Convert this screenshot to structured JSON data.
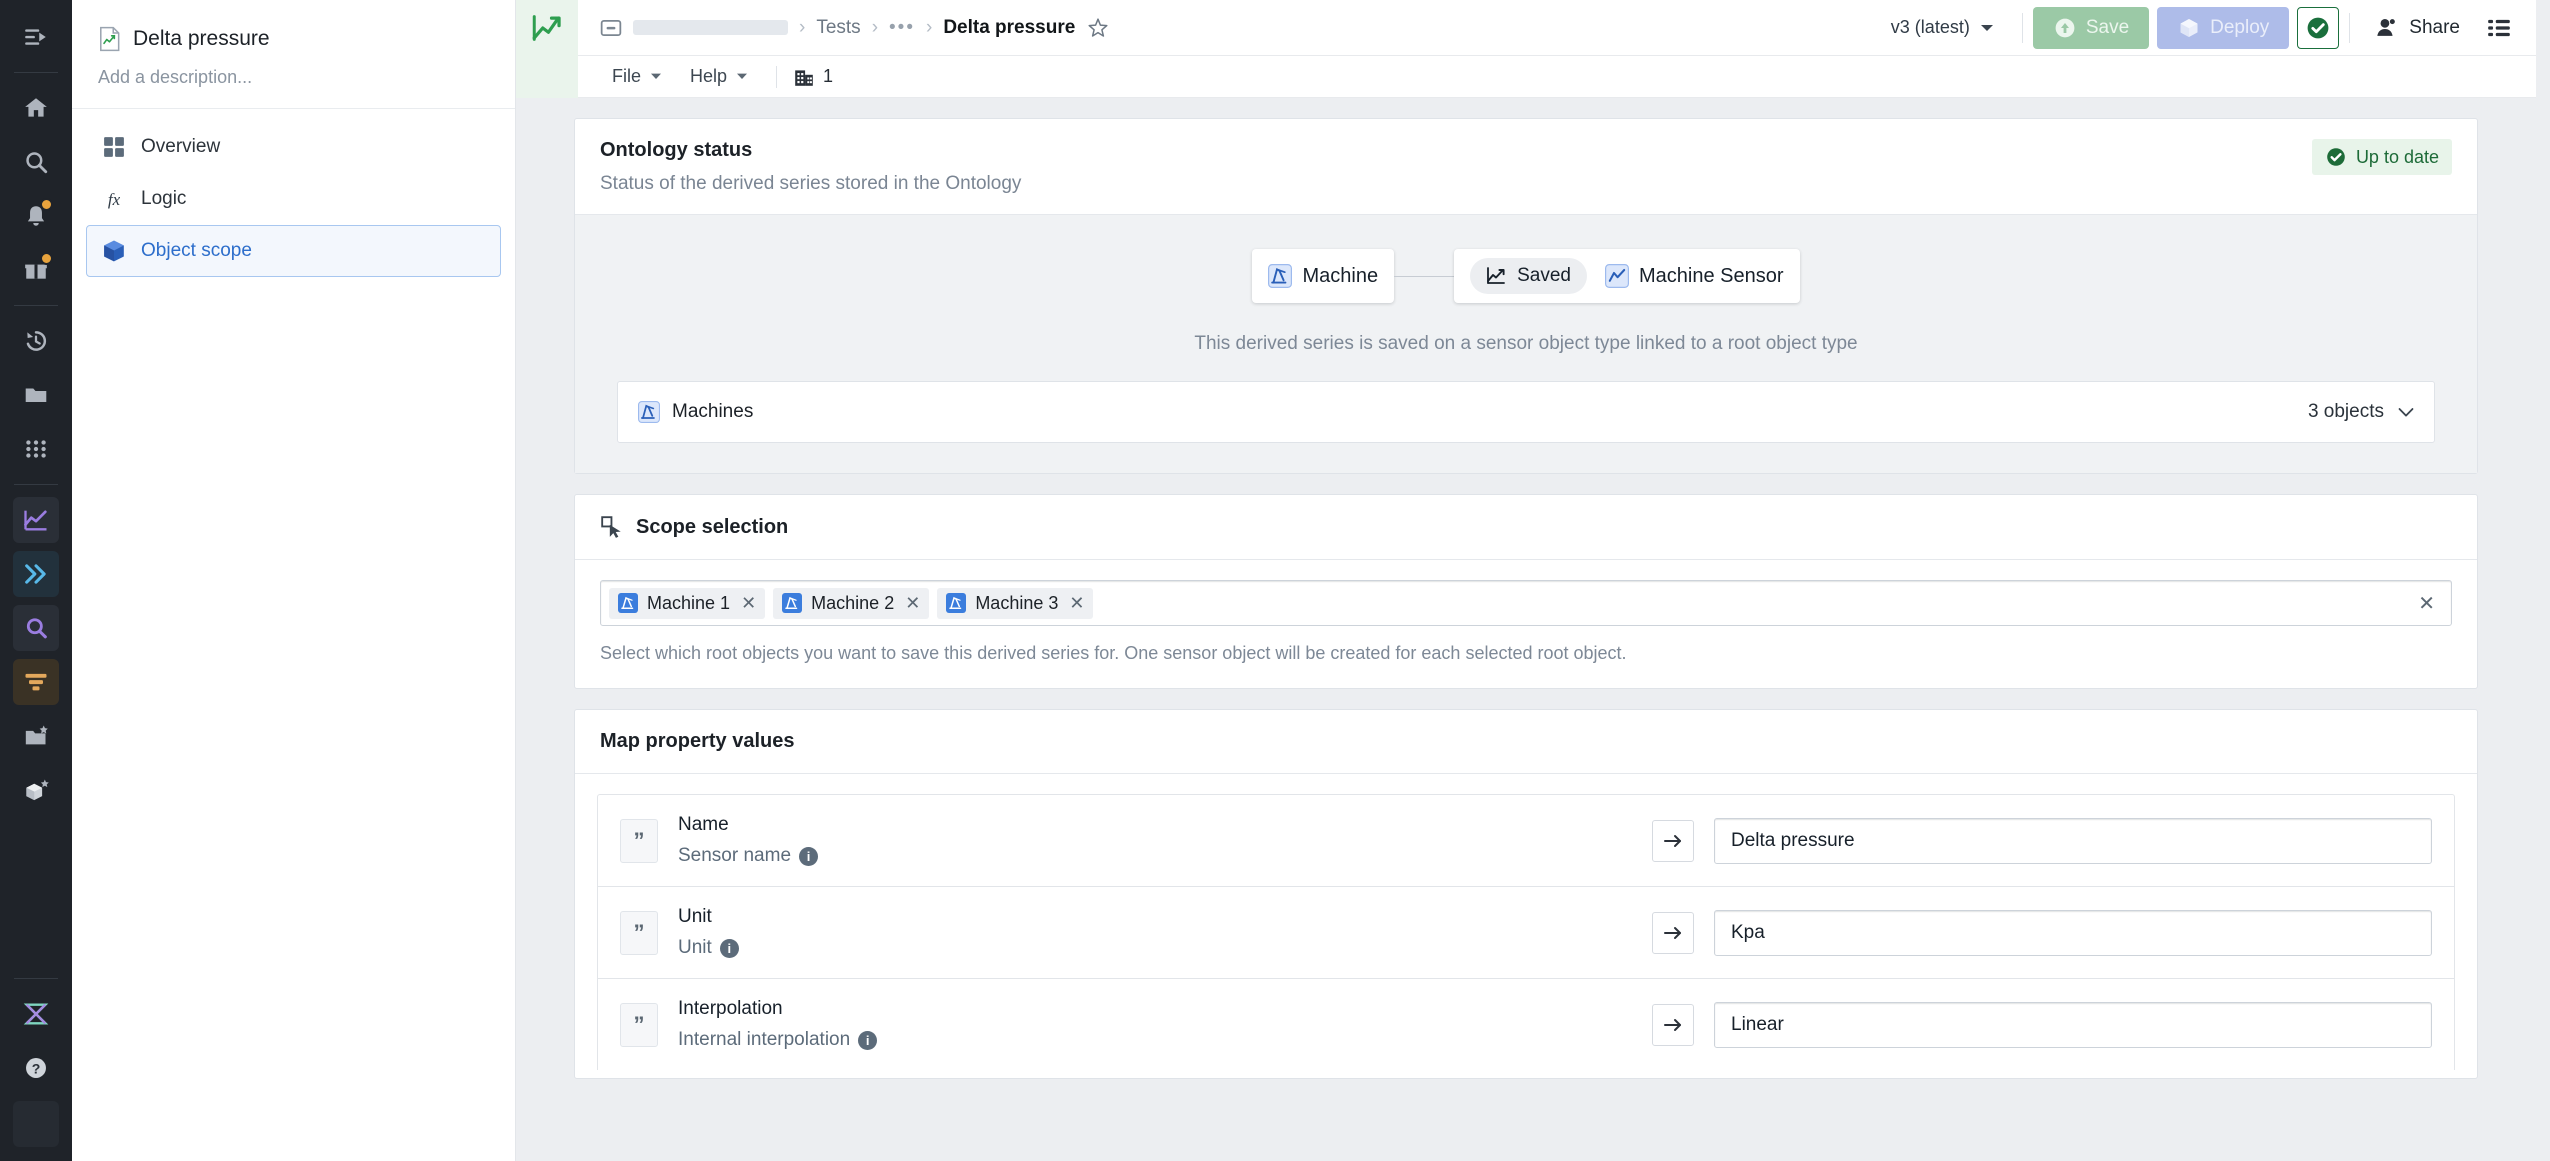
{
  "rail": {
    "collapse_icon": "collapse-sidebar-icon",
    "items": [
      {
        "name": "home-icon"
      },
      {
        "name": "search-icon"
      },
      {
        "name": "notifications-bell-icon",
        "badge": true
      },
      {
        "name": "gifts-icon",
        "badge": true
      },
      {
        "name": "recent-history-icon"
      },
      {
        "name": "folder-icon"
      },
      {
        "name": "apps-grid-icon"
      },
      {
        "name": "chart-app-icon"
      },
      {
        "name": "pipeline-app-icon"
      },
      {
        "name": "search-app-icon"
      },
      {
        "name": "filter-app-icon"
      },
      {
        "name": "folder-star-icon"
      },
      {
        "name": "object-star-icon"
      },
      {
        "name": "ontology-icon"
      },
      {
        "name": "help-icon"
      }
    ]
  },
  "topbar": {
    "logo_icon": "quiver-chart-logo",
    "breadcrumb": {
      "root_icon": "project-icon",
      "skeleton": "",
      "items": [
        "Tests",
        "•••"
      ],
      "current": "Delta pressure",
      "star_icon": "star-outline-icon",
      "separator": "›"
    },
    "version_label": "v3 (latest)",
    "save_label": "Save",
    "deploy_label": "Deploy",
    "check_icon": "validation-check-icon",
    "share_label": "Share",
    "list_icon": "list-view-icon"
  },
  "menubar": {
    "items": [
      {
        "label": "File"
      },
      {
        "label": "Help"
      }
    ],
    "org_icon": "organization-icon",
    "org_count": "1"
  },
  "leftpanel": {
    "doc_icon": "derived-series-doc-icon",
    "title": "Delta pressure",
    "description_placeholder": "Add a description...",
    "nav": [
      {
        "label": "Overview",
        "icon": "overview-grid-icon",
        "active": false
      },
      {
        "label": "Logic",
        "icon": "fx-function-icon",
        "active": false
      },
      {
        "label": "Object scope",
        "icon": "cube-object-icon",
        "active": true
      }
    ]
  },
  "ontology_status": {
    "title": "Ontology status",
    "subtitle": "Status of the derived series stored in the Ontology",
    "badge": {
      "label": "Up to date",
      "icon": "check-circle-icon",
      "color": "#1d6b38"
    },
    "graph": {
      "root_node": {
        "label": "Machine",
        "icon": "machine-object-icon"
      },
      "saved_pill": {
        "label": "Saved",
        "icon": "saved-series-icon"
      },
      "sensor_node": {
        "label": "Machine Sensor",
        "icon": "sensor-series-icon"
      },
      "note": "This derived series is saved on a sensor object type linked to a root object type"
    },
    "object_row": {
      "label": "Machines",
      "icon": "machine-object-icon",
      "count": "3 objects",
      "chevron": "chevron-down-icon"
    }
  },
  "scope_selection": {
    "title": "Scope selection",
    "icon": "scope-cursor-icon",
    "tags": [
      {
        "label": "Machine 1",
        "icon": "machine-object-icon"
      },
      {
        "label": "Machine 2",
        "icon": "machine-object-icon"
      },
      {
        "label": "Machine 3",
        "icon": "machine-object-icon"
      }
    ],
    "clear_icon": "clear-all-icon",
    "tag_remove_icon": "remove-tag-icon",
    "hint": "Select which root objects you want to save this derived series for. One sensor object will be created for each selected root object."
  },
  "map_property_values": {
    "title": "Map property values",
    "rows": [
      {
        "property": "Name",
        "source": "Sensor name",
        "quote_icon": "quote-string-icon",
        "info_icon": "info-icon",
        "arrow_icon": "maps-to-arrow-icon",
        "value": "Delta pressure"
      },
      {
        "property": "Unit",
        "source": "Unit",
        "quote_icon": "quote-string-icon",
        "info_icon": "info-icon",
        "arrow_icon": "maps-to-arrow-icon",
        "value": "Kpa"
      },
      {
        "property": "Interpolation",
        "source": "Internal interpolation",
        "quote_icon": "quote-string-icon",
        "info_icon": "info-icon",
        "arrow_icon": "maps-to-arrow-icon",
        "value": "Linear"
      }
    ]
  },
  "colors": {
    "rail_bg": "#1f2329",
    "accent_blue": "#2d6ecb",
    "status_green": "#1d6b38",
    "content_bg": "#eceef1",
    "badge_orange": "#e8a33d"
  }
}
